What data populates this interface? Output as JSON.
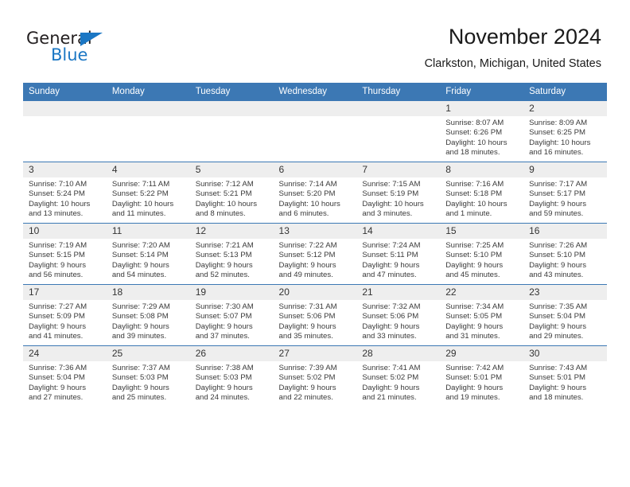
{
  "brand": {
    "name_part1": "General",
    "name_part2": "Blue",
    "triangle_color": "#1b77c4"
  },
  "header": {
    "title": "November 2024",
    "subtitle": "Clarkston, Michigan, United States",
    "accent_color": "#3c78b4",
    "daynum_bg": "#eeeeee"
  },
  "weekdays": [
    "Sunday",
    "Monday",
    "Tuesday",
    "Wednesday",
    "Thursday",
    "Friday",
    "Saturday"
  ],
  "weeks": [
    [
      {
        "day": "",
        "empty": true
      },
      {
        "day": "",
        "empty": true
      },
      {
        "day": "",
        "empty": true
      },
      {
        "day": "",
        "empty": true
      },
      {
        "day": "",
        "empty": true
      },
      {
        "day": "1",
        "sunrise": "Sunrise: 8:07 AM",
        "sunset": "Sunset: 6:26 PM",
        "daylight1": "Daylight: 10 hours",
        "daylight2": "and 18 minutes."
      },
      {
        "day": "2",
        "sunrise": "Sunrise: 8:09 AM",
        "sunset": "Sunset: 6:25 PM",
        "daylight1": "Daylight: 10 hours",
        "daylight2": "and 16 minutes."
      }
    ],
    [
      {
        "day": "3",
        "sunrise": "Sunrise: 7:10 AM",
        "sunset": "Sunset: 5:24 PM",
        "daylight1": "Daylight: 10 hours",
        "daylight2": "and 13 minutes."
      },
      {
        "day": "4",
        "sunrise": "Sunrise: 7:11 AM",
        "sunset": "Sunset: 5:22 PM",
        "daylight1": "Daylight: 10 hours",
        "daylight2": "and 11 minutes."
      },
      {
        "day": "5",
        "sunrise": "Sunrise: 7:12 AM",
        "sunset": "Sunset: 5:21 PM",
        "daylight1": "Daylight: 10 hours",
        "daylight2": "and 8 minutes."
      },
      {
        "day": "6",
        "sunrise": "Sunrise: 7:14 AM",
        "sunset": "Sunset: 5:20 PM",
        "daylight1": "Daylight: 10 hours",
        "daylight2": "and 6 minutes."
      },
      {
        "day": "7",
        "sunrise": "Sunrise: 7:15 AM",
        "sunset": "Sunset: 5:19 PM",
        "daylight1": "Daylight: 10 hours",
        "daylight2": "and 3 minutes."
      },
      {
        "day": "8",
        "sunrise": "Sunrise: 7:16 AM",
        "sunset": "Sunset: 5:18 PM",
        "daylight1": "Daylight: 10 hours",
        "daylight2": "and 1 minute."
      },
      {
        "day": "9",
        "sunrise": "Sunrise: 7:17 AM",
        "sunset": "Sunset: 5:17 PM",
        "daylight1": "Daylight: 9 hours",
        "daylight2": "and 59 minutes."
      }
    ],
    [
      {
        "day": "10",
        "sunrise": "Sunrise: 7:19 AM",
        "sunset": "Sunset: 5:15 PM",
        "daylight1": "Daylight: 9 hours",
        "daylight2": "and 56 minutes."
      },
      {
        "day": "11",
        "sunrise": "Sunrise: 7:20 AM",
        "sunset": "Sunset: 5:14 PM",
        "daylight1": "Daylight: 9 hours",
        "daylight2": "and 54 minutes."
      },
      {
        "day": "12",
        "sunrise": "Sunrise: 7:21 AM",
        "sunset": "Sunset: 5:13 PM",
        "daylight1": "Daylight: 9 hours",
        "daylight2": "and 52 minutes."
      },
      {
        "day": "13",
        "sunrise": "Sunrise: 7:22 AM",
        "sunset": "Sunset: 5:12 PM",
        "daylight1": "Daylight: 9 hours",
        "daylight2": "and 49 minutes."
      },
      {
        "day": "14",
        "sunrise": "Sunrise: 7:24 AM",
        "sunset": "Sunset: 5:11 PM",
        "daylight1": "Daylight: 9 hours",
        "daylight2": "and 47 minutes."
      },
      {
        "day": "15",
        "sunrise": "Sunrise: 7:25 AM",
        "sunset": "Sunset: 5:10 PM",
        "daylight1": "Daylight: 9 hours",
        "daylight2": "and 45 minutes."
      },
      {
        "day": "16",
        "sunrise": "Sunrise: 7:26 AM",
        "sunset": "Sunset: 5:10 PM",
        "daylight1": "Daylight: 9 hours",
        "daylight2": "and 43 minutes."
      }
    ],
    [
      {
        "day": "17",
        "sunrise": "Sunrise: 7:27 AM",
        "sunset": "Sunset: 5:09 PM",
        "daylight1": "Daylight: 9 hours",
        "daylight2": "and 41 minutes."
      },
      {
        "day": "18",
        "sunrise": "Sunrise: 7:29 AM",
        "sunset": "Sunset: 5:08 PM",
        "daylight1": "Daylight: 9 hours",
        "daylight2": "and 39 minutes."
      },
      {
        "day": "19",
        "sunrise": "Sunrise: 7:30 AM",
        "sunset": "Sunset: 5:07 PM",
        "daylight1": "Daylight: 9 hours",
        "daylight2": "and 37 minutes."
      },
      {
        "day": "20",
        "sunrise": "Sunrise: 7:31 AM",
        "sunset": "Sunset: 5:06 PM",
        "daylight1": "Daylight: 9 hours",
        "daylight2": "and 35 minutes."
      },
      {
        "day": "21",
        "sunrise": "Sunrise: 7:32 AM",
        "sunset": "Sunset: 5:06 PM",
        "daylight1": "Daylight: 9 hours",
        "daylight2": "and 33 minutes."
      },
      {
        "day": "22",
        "sunrise": "Sunrise: 7:34 AM",
        "sunset": "Sunset: 5:05 PM",
        "daylight1": "Daylight: 9 hours",
        "daylight2": "and 31 minutes."
      },
      {
        "day": "23",
        "sunrise": "Sunrise: 7:35 AM",
        "sunset": "Sunset: 5:04 PM",
        "daylight1": "Daylight: 9 hours",
        "daylight2": "and 29 minutes."
      }
    ],
    [
      {
        "day": "24",
        "sunrise": "Sunrise: 7:36 AM",
        "sunset": "Sunset: 5:04 PM",
        "daylight1": "Daylight: 9 hours",
        "daylight2": "and 27 minutes."
      },
      {
        "day": "25",
        "sunrise": "Sunrise: 7:37 AM",
        "sunset": "Sunset: 5:03 PM",
        "daylight1": "Daylight: 9 hours",
        "daylight2": "and 25 minutes."
      },
      {
        "day": "26",
        "sunrise": "Sunrise: 7:38 AM",
        "sunset": "Sunset: 5:03 PM",
        "daylight1": "Daylight: 9 hours",
        "daylight2": "and 24 minutes."
      },
      {
        "day": "27",
        "sunrise": "Sunrise: 7:39 AM",
        "sunset": "Sunset: 5:02 PM",
        "daylight1": "Daylight: 9 hours",
        "daylight2": "and 22 minutes."
      },
      {
        "day": "28",
        "sunrise": "Sunrise: 7:41 AM",
        "sunset": "Sunset: 5:02 PM",
        "daylight1": "Daylight: 9 hours",
        "daylight2": "and 21 minutes."
      },
      {
        "day": "29",
        "sunrise": "Sunrise: 7:42 AM",
        "sunset": "Sunset: 5:01 PM",
        "daylight1": "Daylight: 9 hours",
        "daylight2": "and 19 minutes."
      },
      {
        "day": "30",
        "sunrise": "Sunrise: 7:43 AM",
        "sunset": "Sunset: 5:01 PM",
        "daylight1": "Daylight: 9 hours",
        "daylight2": "and 18 minutes."
      }
    ]
  ]
}
